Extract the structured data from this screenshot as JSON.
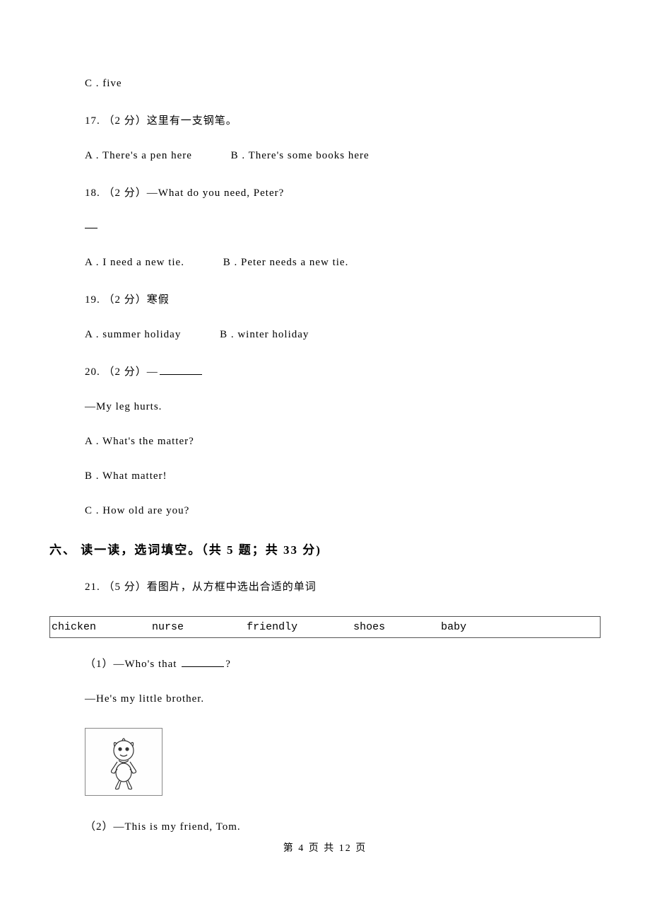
{
  "q16_c": "C . five",
  "q17_stem": "17. （2 分）这里有一支钢笔。",
  "q17_a": "A . There's a pen here",
  "q17_b": "B . There's some books here",
  "q18_stem": "18. （2 分）—What do you need, Peter?",
  "q18_a": "A . I need a new tie.",
  "q18_b": "B . Peter needs a new tie.",
  "q19_stem": "19. （2 分）寒假",
  "q19_a": "A . summer holiday",
  "q19_b": "B . winter holiday",
  "q20_stem_pre": "20. （2 分）—",
  "q20_reply": "—My leg hurts.",
  "q20_a": "A . What's the matter?",
  "q20_b": "B . What matter!",
  "q20_c": "C . How old are you?",
  "section6_heading": "六、 读一读，选词填空。（共 5 题；共 33 分)",
  "q21_stem": "21. （5 分）看图片，从方框中选出合适的单词",
  "wordbank": {
    "w1": "chicken",
    "w2": "nurse",
    "w3": "friendly",
    "w4": "shoes",
    "w5": "baby"
  },
  "q21_1_pre": "（1）—Who's that ",
  "q21_1_post": "?",
  "q21_1_reply": "—He's my little brother.",
  "q21_2": "（2）—This is my friend, Tom.",
  "footer": "第 4 页 共 12 页"
}
